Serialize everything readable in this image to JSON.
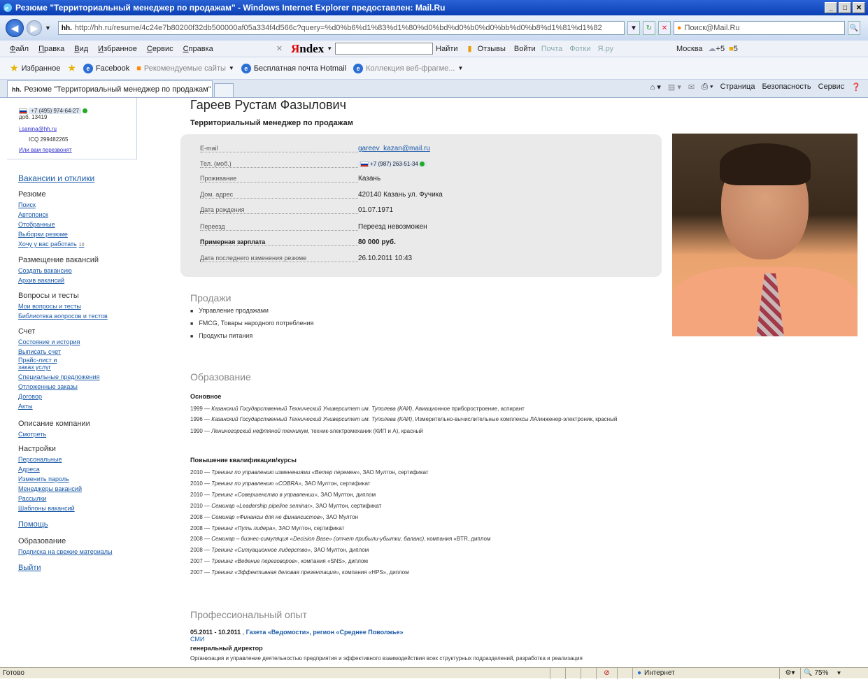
{
  "window": {
    "title": "Резюме \"Территориальный менеджер по продажам\" - Windows Internet Explorer предоставлен: Mail.Ru",
    "min": "_",
    "max": "□"
  },
  "address": {
    "url": "http://hh.ru/resume/4c24e7b80200f32db500000af05a334f4d566c?query=%d0%b6%d1%83%d1%80%d0%bd%d0%b0%d0%bb%d0%b8%d1%81%d1%82",
    "search_placeholder": "Поиск@Mail.Ru"
  },
  "menu": {
    "items": [
      "Файл",
      "Правка",
      "Вид",
      "Избранное",
      "Сервис",
      "Справка"
    ],
    "yandex_find": "Найти",
    "reviews": "Отзывы",
    "login": "Войти",
    "mail": "Почта",
    "photos": "Фотки",
    "yaru": "Я.ру",
    "city": "Москва",
    "temp": "+5",
    "score": "5"
  },
  "favorites": {
    "label": "Избранное",
    "items": [
      "Facebook",
      "Рекомендуемые сайты",
      "Бесплатная почта Hotmail",
      "Коллекция веб-фрагме..."
    ]
  },
  "tab": {
    "title": "Резюме \"Территориальный менеджер по продажам\"",
    "brand": "hh."
  },
  "commandbar": {
    "page": "Страница",
    "security": "Безопасность",
    "service": "Сервис"
  },
  "leftnav": {
    "contact": {
      "phone": "+7 (495) 974-64-27",
      "ext": "доб. 13419",
      "email": "i.sanina@hh.ru",
      "icq": "ICQ 299482265",
      "callback": "Или вам перезвонят"
    },
    "vacancies": "Вакансии и отклики",
    "resume": {
      "title": "Резюме",
      "links": [
        "Поиск",
        "Автопоиск",
        "Отобранные",
        "Выборки резюме",
        "Хочу у вас работать"
      ],
      "count": "10"
    },
    "posting": {
      "title": "Размещение вакансий",
      "links": [
        "Создать вакансию",
        "Архив вакансий"
      ]
    },
    "tests": {
      "title": "Вопросы и тесты",
      "links": [
        "Мои вопросы и тесты",
        "Библиотека вопросов и тестов"
      ]
    },
    "account": {
      "title": "Счет",
      "links": [
        "Состояние и история",
        "Выписать счет",
        "Прайс-лист и",
        "заказ услуг",
        "Специальные предложения",
        "Отложенные заказы",
        "Договор",
        "Акты"
      ]
    },
    "company": {
      "title": "Описание компании",
      "links": [
        "Смотреть"
      ]
    },
    "settings": {
      "title": "Настройки",
      "links": [
        "Персональные",
        "Адреса",
        "Изменить пароль",
        "Менеджеры вакансий",
        "Рассылки",
        "Шаблоны вакансий"
      ]
    },
    "help": "Помощь",
    "education": {
      "title": "Образование",
      "links": [
        "Подписка на свежие материалы"
      ]
    },
    "logout": "Выйти"
  },
  "resume": {
    "name": "Гареев Рустам Фазылович",
    "position": "Территориальный менеджер по продажам",
    "info": [
      {
        "k": "E-mail",
        "v": "gareev_kazan@mail.ru"
      },
      {
        "k": "Тел. (моб.)",
        "v": "+7 (987) 263-51-34"
      },
      {
        "k": "Проживание",
        "v": "Казань"
      },
      {
        "k": "Дом. адрес",
        "v": "420140 Казань ул. Фучика"
      },
      {
        "k": "Дата рождения",
        "v": "01.07.1971"
      },
      {
        "k": "Переезд",
        "v": "Переезд невозможен"
      },
      {
        "k": "Примерная зарплата",
        "v": "80 000 руб."
      },
      {
        "k": "Дата последнего изменения резюме",
        "v": "26.10.2011 10:43"
      }
    ],
    "sales_title": "Продажи",
    "sales": [
      "Управление продажами",
      "FMCG, Товары народного потребления",
      "Продукты питания"
    ],
    "edu_title": "Образование",
    "edu_main_title": "Основное",
    "edu_main": [
      {
        "y": "1999 — ",
        "i": "Казанский Государственный Технический Университет им. Туполева (КАИ)",
        "t": ", Авиационное приборостроение, аспирант"
      },
      {
        "y": "1996 — ",
        "i": "Казанский Государственный Технический Университет им. Туполева (КАИ)",
        "t": ", Измерительно-вычислительные комплексы ЛА/инженер-электроник, красный"
      },
      {
        "y": "1990 — ",
        "i": "Лениногорский нефтяной техникум",
        "t": ", техник-электромеханик (КИП и А), красный"
      }
    ],
    "courses_title": "Повышение квалификации/курсы",
    "courses": [
      {
        "y": "2010 — ",
        "i": "Тренинг по управлению изменениями «Ветер перемен»",
        "t": ", ЗАО Мултон, сертификат"
      },
      {
        "y": "2010 — ",
        "i": "Тренинг по управлению «COBRA»",
        "t": ", ЗАО Мултон, сертификат"
      },
      {
        "y": "2010 — ",
        "i": "Тренинг «Совершенство в управлении»",
        "t": ", ЗАО Мултон, диплом"
      },
      {
        "y": "2010 — ",
        "i": "Семинар «Leadership pipeline seminar»",
        "t": ", ЗАО Мултон, сертификат"
      },
      {
        "y": "2008 — ",
        "i": "Семинар «Финансы для не финансистов»",
        "t": ", ЗАО Мултон"
      },
      {
        "y": "2008 — ",
        "i": "Тренинг «Путь лидера»",
        "t": ", ЗАО Мултон, сертификат"
      },
      {
        "y": "2008 — ",
        "i": "Семинар – бизнес-симуляция «Decision Base» (отчет прибыли-убытки, баланс)",
        "t": ", компания «BTR, диплом"
      },
      {
        "y": "2008 — ",
        "i": "Тренинг «Ситуационное лидерство»",
        "t": ", ЗАО Мултон, диплом"
      },
      {
        "y": "2007 — ",
        "i": "Тренинг «Ведение переговоров»",
        "t": ", компания «SNS», диплом"
      },
      {
        "y": "2007 — ",
        "i": "Тренинг «Эффективная деловая презентация»",
        "t": ", компания «HPS», диплом"
      }
    ],
    "exp_title": "Профессиональный опыт",
    "exp": {
      "dates": "05.2011 - 10.2011",
      "company": "Газета «Ведомости», регион «Среднее Поволжье»",
      "industry": "СМИ",
      "role": "генеральный директор",
      "desc": "Организация и управление деятельностью предприятия и эффективного взаимодействия всех структурных подразделений, разработка и реализация"
    }
  },
  "status": {
    "ready": "Готово",
    "zone": "Интернет",
    "zoom": "75%"
  }
}
